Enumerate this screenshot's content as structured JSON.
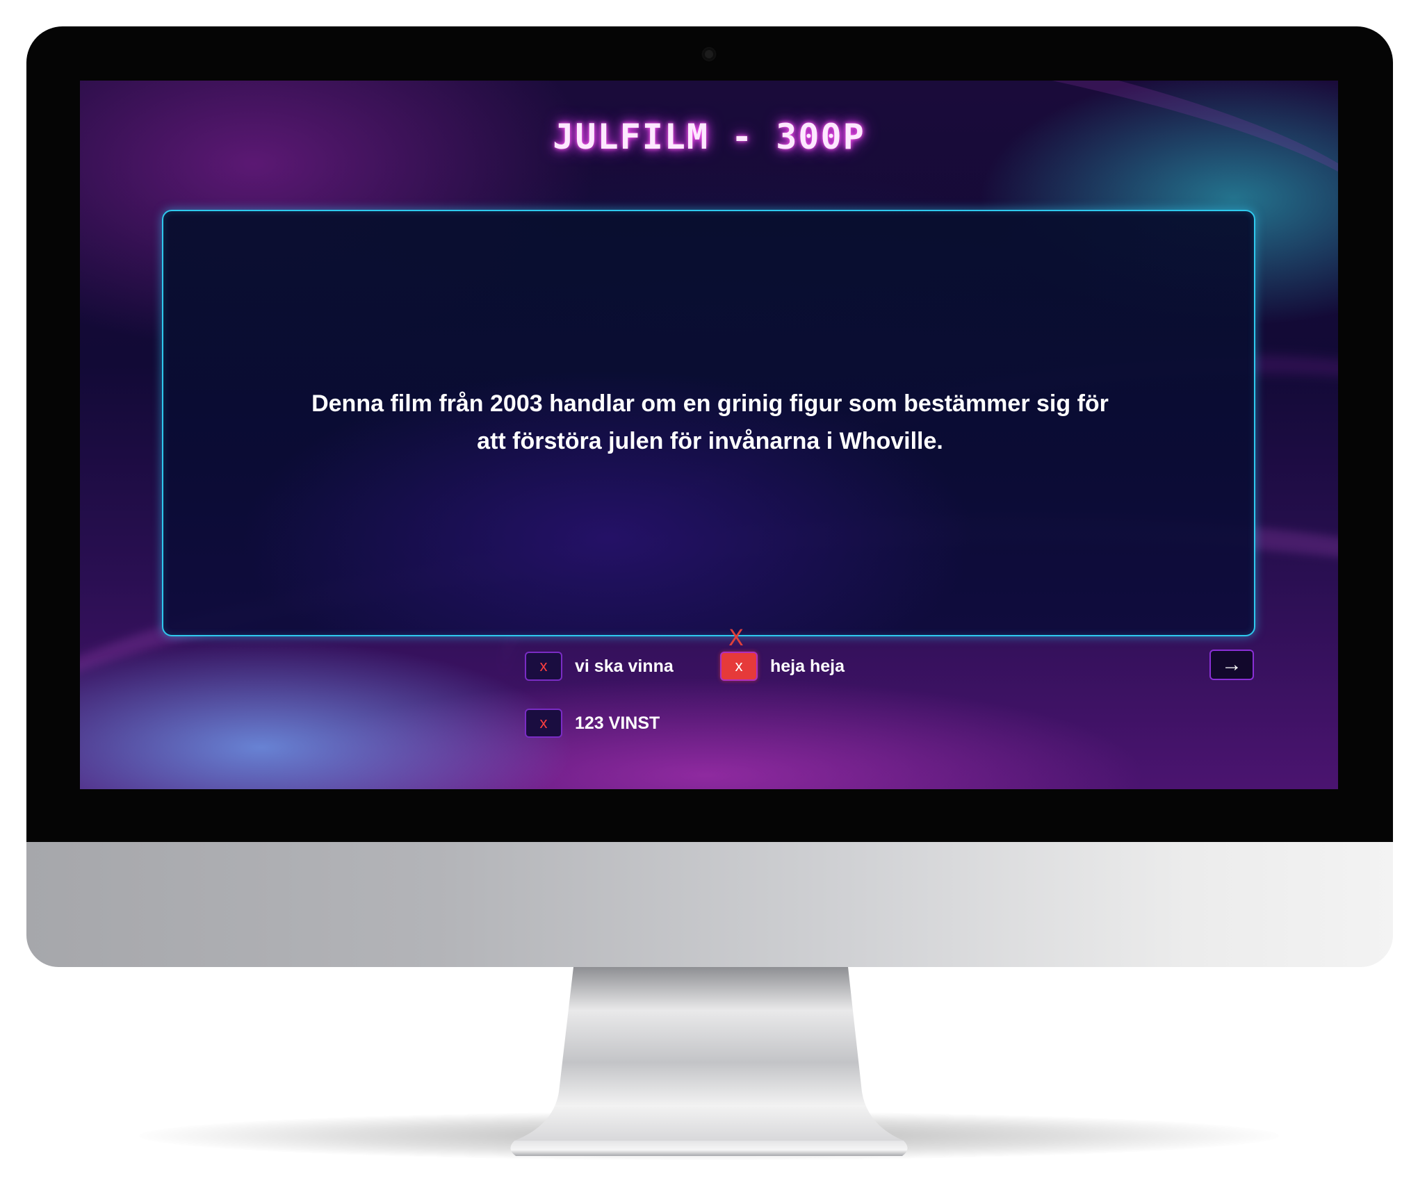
{
  "screen": {
    "title": "JULFILM - 300P",
    "question": "Denna film från 2003 handlar om en grinig figur som bestämmer sig för att förstöra julen för invånarna i Whoville.",
    "wrong_marker": "X",
    "teams": [
      {
        "strike_label": "x",
        "name": "vi ska vinna",
        "striked": false
      },
      {
        "strike_label": "x",
        "name": "heja heja",
        "striked": true
      },
      {
        "strike_label": "x",
        "name": "123 VINST",
        "striked": false
      }
    ],
    "next_button": {
      "icon": "arrow-right-icon",
      "glyph": "→"
    }
  },
  "colors": {
    "accent_cyan": "#2fc9ee",
    "accent_purple": "#8a2fd6",
    "strike_red": "#e63a3a",
    "title_glow": "#ff59f0"
  }
}
